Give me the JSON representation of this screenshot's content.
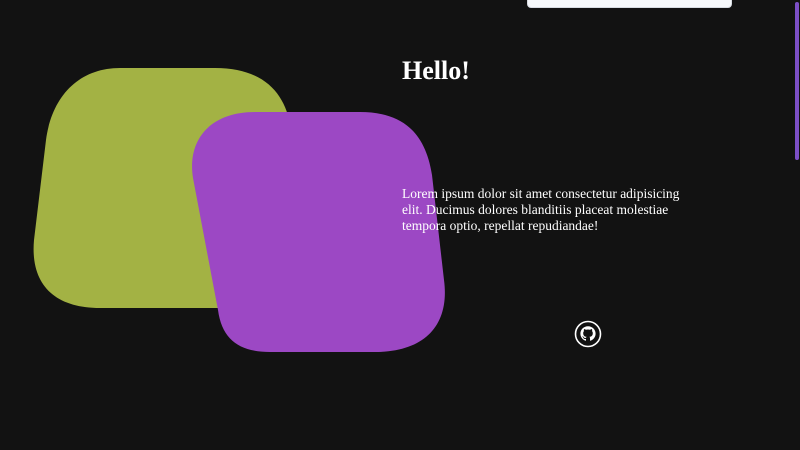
{
  "hero": {
    "heading": "Hello!",
    "description": "Lorem ipsum dolor sit amet consectetur adipisicing elit. Ducimus dolores blanditiis placeat molestiae tempora optio, repellat repudiandae!"
  },
  "links": {
    "github_icon": "github-icon"
  },
  "colors": {
    "background": "#121212",
    "blob_green": "#a3b244",
    "blob_purple": "#9c48c4",
    "scrollbar_thumb": "#7c4fc6",
    "text": "#ffffff"
  }
}
